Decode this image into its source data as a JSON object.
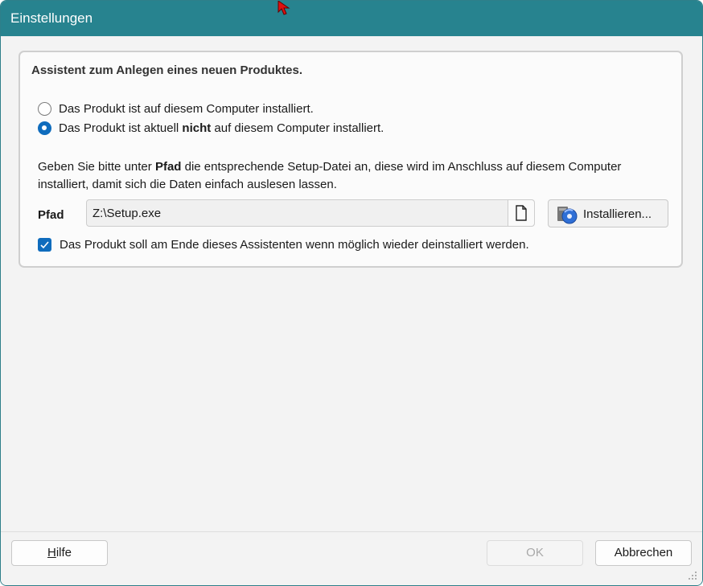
{
  "window": {
    "title": "Einstellungen"
  },
  "group": {
    "heading": "Assistent zum Anlegen eines neuen Produktes.",
    "options": [
      {
        "label_before": "Das Produkt ist auf diesem Computer installiert.",
        "label_bold": "",
        "label_after": "",
        "selected": false
      },
      {
        "label_before": "Das Produkt ist aktuell ",
        "label_bold": "nicht",
        "label_after": " auf diesem Computer installiert.",
        "selected": true
      }
    ],
    "description": {
      "before": "Geben Sie bitte unter ",
      "bold": "Pfad",
      "after": " die entsprechende Setup-Datei an, diese wird im Anschluss auf diesem Computer installiert, damit sich die Daten einfach auslesen lassen."
    },
    "path": {
      "label": "Pfad",
      "value": "Z:\\Setup.exe"
    },
    "install_button": {
      "label": "Installieren..."
    },
    "uninstall_checkbox": {
      "label": "Das Produkt soll am Ende dieses Assistenten wenn möglich wieder deinstalliert werden.",
      "checked": true
    }
  },
  "footer": {
    "help_label_accel": "H",
    "help_label_rest": "ilfe",
    "ok_label": "OK",
    "cancel_label": "Abbrechen"
  },
  "colors": {
    "titlebar": "#27838f",
    "accent": "#0f6cbd"
  }
}
